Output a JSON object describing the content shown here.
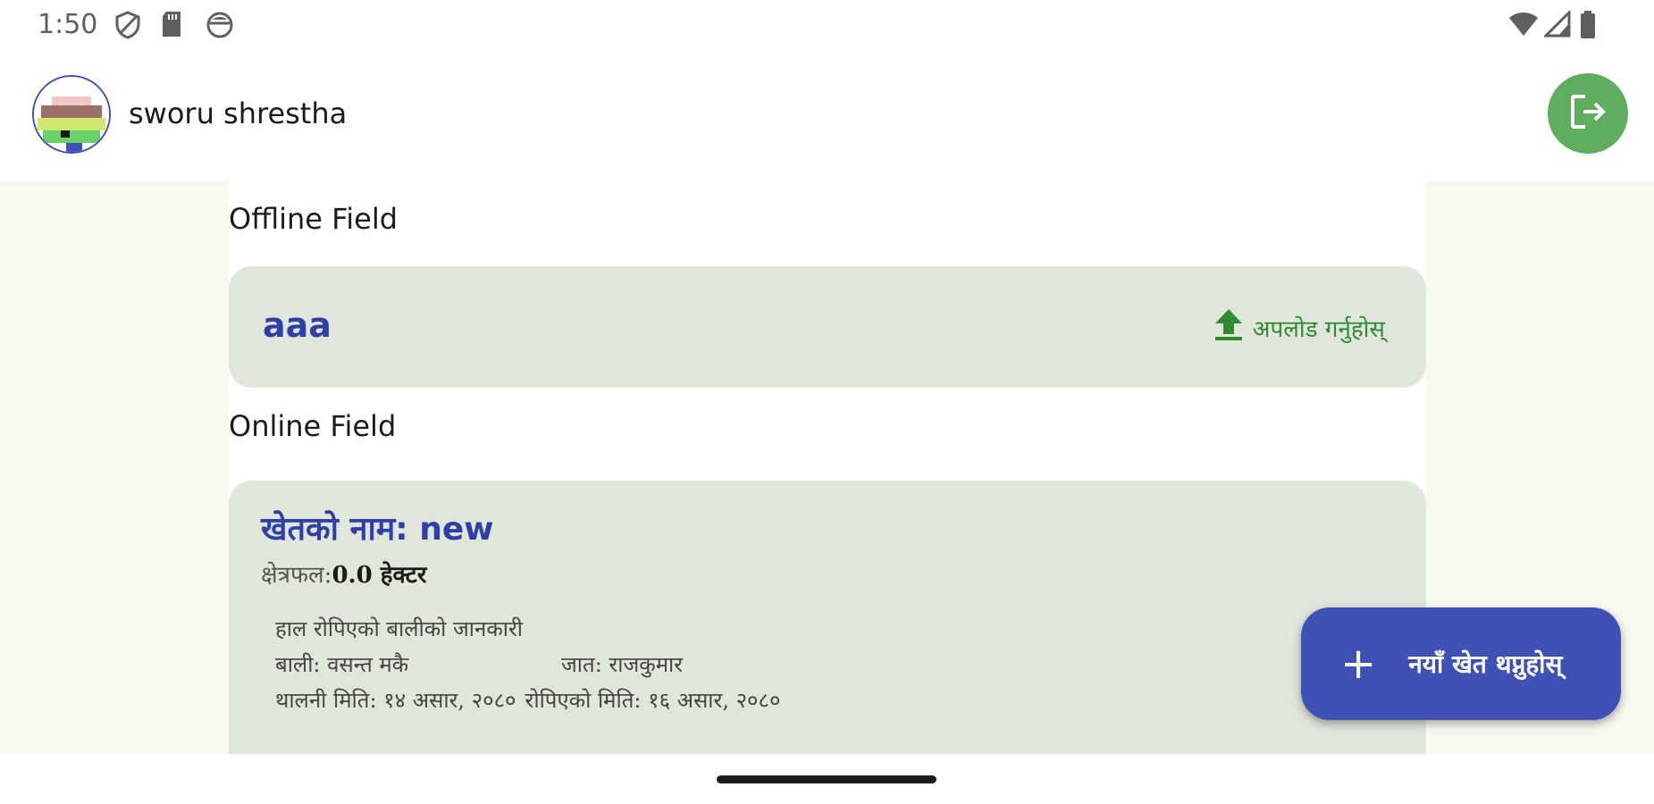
{
  "status_bar": {
    "time": "1:50",
    "left_icons": [
      "shield-icon",
      "sd-card-icon",
      "vpn-icon"
    ],
    "right_icons": [
      "wifi-icon",
      "signal-icon",
      "battery-icon"
    ]
  },
  "header": {
    "user_name": "sworu shrestha",
    "logout_icon": "logout-icon",
    "logout_color": "#5fae5f"
  },
  "offline_section": {
    "title": "Offline Field",
    "field_name": "aaa",
    "upload_label": "अपलोड गर्नुहोस्",
    "upload_icon": "upload-icon"
  },
  "online_section": {
    "title": "Online Field",
    "field_title": "खेतको नाम: new",
    "area_label": "क्षेत्रफल:",
    "area_value": "0.0 हेक्टर",
    "crop_heading": "हाल रोपिएको बालीको जानकारी",
    "crop_label": "बाली: वसन्त मकै",
    "variety_label": "जात: राजकुमार",
    "sowing_date": "थालनी मिति: १४ असार, २०८०",
    "planting_date": "रोपिएको मिति: १६ असार, २०८०"
  },
  "fab": {
    "label": "नयाँ खेत थप्नुहोस्",
    "icon": "plus-icon",
    "color": "#3f51b5"
  }
}
